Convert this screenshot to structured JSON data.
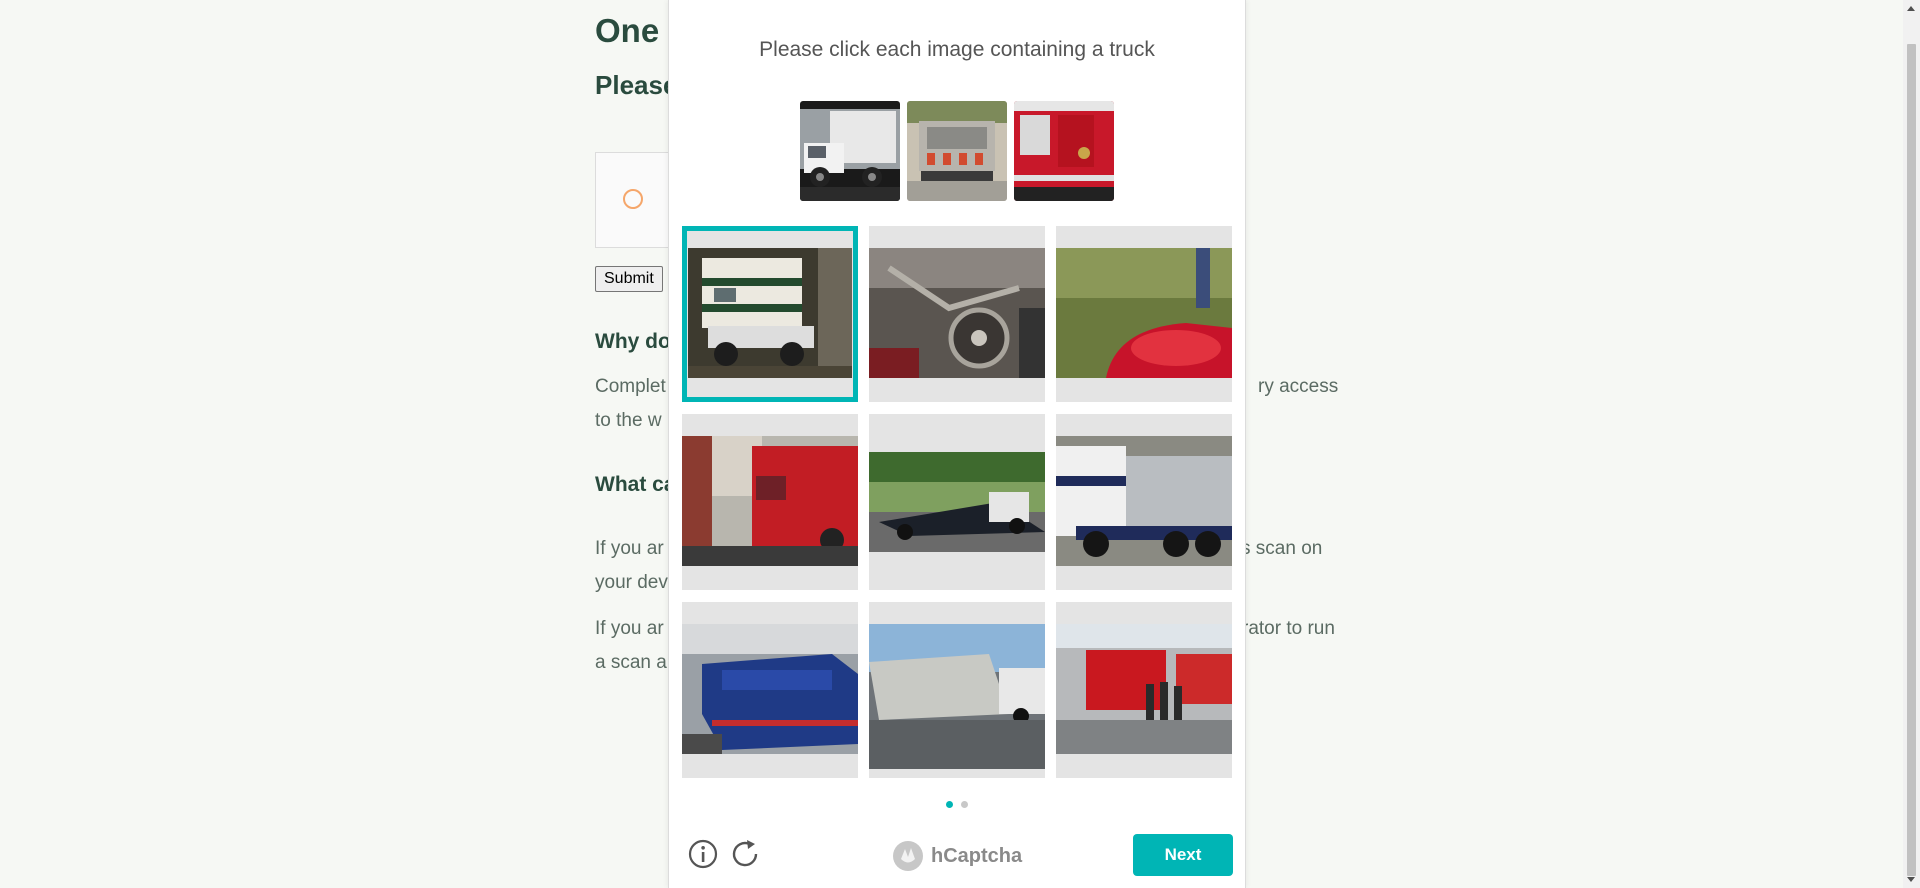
{
  "page": {
    "title": "One",
    "subtitle": "Please",
    "submit_label": "Submit",
    "why_heading": "Why do",
    "why_line1_left": "Complet",
    "why_line1_right": "ry access",
    "why_line2": "to the w",
    "what_heading": "What ca",
    "p1_line1_left": "If you ar",
    "p1_line1_right": "s scan on",
    "p1_line2": "your dev",
    "p2_line1_left": "If you ar",
    "p2_line1_right": "rator to run",
    "p2_line2": "a scan a"
  },
  "captcha": {
    "prompt": "Please click each image containing a truck",
    "examples": [
      "white box truck",
      "street sweeper truck",
      "red fire truck"
    ],
    "tiles": [
      {
        "label": "camper on pickup truck",
        "selected": true
      },
      {
        "label": "bicycle chain and gears",
        "selected": false
      },
      {
        "label": "red motorcycle seat on grass",
        "selected": false
      },
      {
        "label": "red fire truck near brick building",
        "selected": false
      },
      {
        "label": "flatbed tow truck",
        "selected": false
      },
      {
        "label": "tanker semi truck",
        "selected": false
      },
      {
        "label": "blue train at station",
        "selected": false
      },
      {
        "label": "truck towing mobile home",
        "selected": false
      },
      {
        "label": "fire trucks with firefighters",
        "selected": false
      }
    ],
    "pages": 2,
    "current_page": 1,
    "brand": "hCaptcha",
    "next_label": "Next",
    "accent_color": "#00b5b5"
  }
}
